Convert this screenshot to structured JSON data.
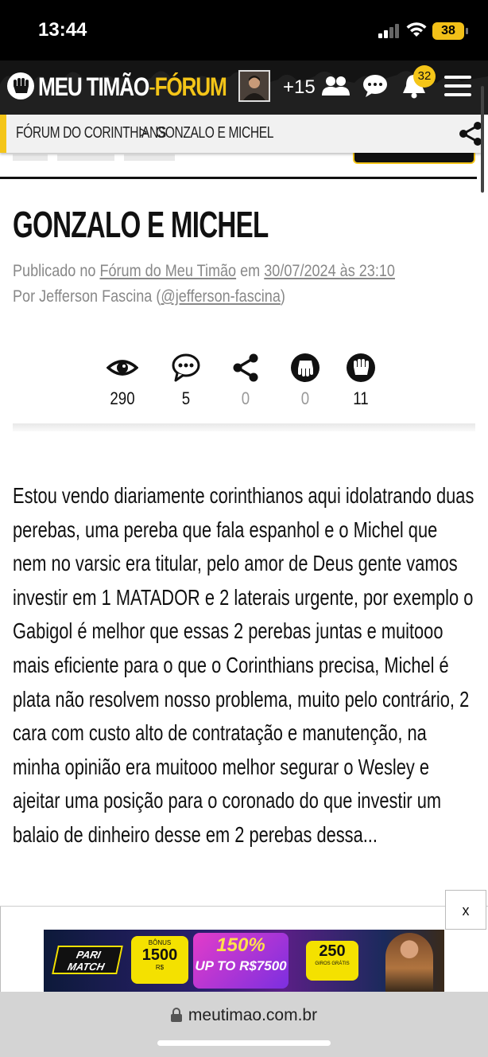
{
  "status_bar": {
    "time": "13:44",
    "battery": "38"
  },
  "header": {
    "brand_primary": "MEU TIMÃO",
    "brand_separator": "-",
    "brand_secondary": "FÓRUM",
    "online_count": "+15",
    "notifications_badge": "32",
    "icons": [
      "fist-logo-icon",
      "users-icon",
      "chat-bubble-icon",
      "bell-icon",
      "hamburger-menu-icon"
    ]
  },
  "breadcrumb": {
    "root": "FÓRUM DO CORINTHIANS",
    "separator": ">",
    "current": "GONZALO E MICHEL"
  },
  "article": {
    "title": "GONZALO E MICHEL",
    "published_prefix": "Publicado no",
    "forum_link": "Fórum do Meu Timão",
    "date_prefix": "em",
    "date_link": "30/07/2024 às 23:10",
    "author_prefix": "Por Jefferson Fascina (",
    "author_handle": "@jefferson-fascina",
    "author_suffix": ")",
    "stats": {
      "views": "290",
      "comments": "5",
      "shares": "0",
      "dislikes": "0",
      "likes": "11"
    },
    "body": "Estou vendo diariamente corinthianos aqui idolatrando duas perebas, uma pereba que fala espanhol e o Michel que nem no varsic era titular, pelo amor de Deus gente vamos investir em 1 MATADOR e 2 laterais urgente, por exemplo o Gabigol é melhor que essas 2 perebas juntas e muitooo mais eficiente para o que o Corinthians precisa, Michel é plata não resolvem nosso problema, muito pelo contrário, 2 cara com custo alto de contratação e manutenção, na minha opinião era muitooo melhor segurar o Wesley e ajeitar uma posição para o coronado do que investir um balaio de dinheiro desse em 2 perebas dessa..."
  },
  "ad": {
    "close_label": "x",
    "brand": "PARI MATCH",
    "bonus_small": "BÔNUS",
    "bonus_amount": "1500",
    "bonus_currency": "R$",
    "percent": "150%",
    "upto": "UP TO R$7500",
    "spins_number": "250",
    "spins_text": "GIROS GRÁTIS"
  },
  "browser": {
    "url": "meutimao.com.br"
  },
  "colors": {
    "accent_yellow": "#f4c518",
    "header_bg": "#141414",
    "breadcrumb_bg": "#f1f1f1"
  }
}
